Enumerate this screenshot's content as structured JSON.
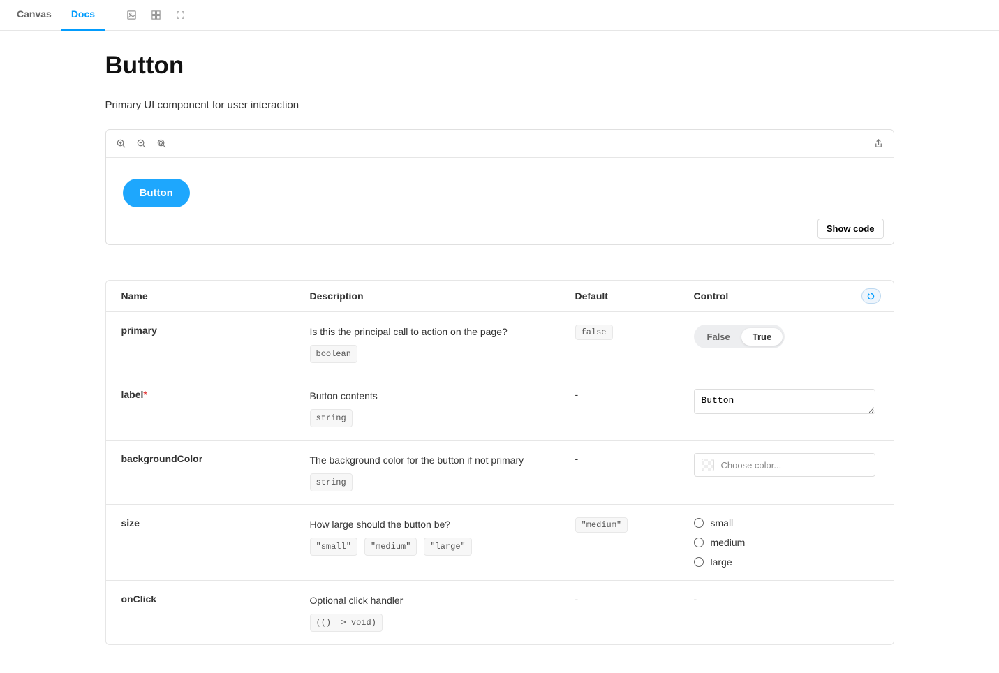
{
  "tabs": {
    "canvas": "Canvas",
    "docs": "Docs"
  },
  "page": {
    "title": "Button",
    "subtitle": "Primary UI component for user interaction"
  },
  "preview": {
    "button_label": "Button",
    "show_code": "Show code"
  },
  "table": {
    "headers": {
      "name": "Name",
      "description": "Description",
      "default": "Default",
      "control": "Control"
    },
    "rows": {
      "primary": {
        "name": "primary",
        "desc": "Is this the principal call to action on the page?",
        "type": "boolean",
        "default": "false",
        "toggle": {
          "false": "False",
          "true": "True"
        }
      },
      "label": {
        "name": "label",
        "desc": "Button contents",
        "type": "string",
        "default": "-",
        "value": "Button"
      },
      "backgroundColor": {
        "name": "backgroundColor",
        "desc": "The background color for the button if not primary",
        "type": "string",
        "default": "-",
        "placeholder": "Choose color..."
      },
      "size": {
        "name": "size",
        "desc": "How large should the button be?",
        "options": [
          "\"small\"",
          "\"medium\"",
          "\"large\""
        ],
        "default": "\"medium\"",
        "radios": [
          "small",
          "medium",
          "large"
        ]
      },
      "onClick": {
        "name": "onClick",
        "desc": "Optional click handler",
        "type": "(() => void)",
        "default": "-",
        "control": "-"
      }
    }
  }
}
